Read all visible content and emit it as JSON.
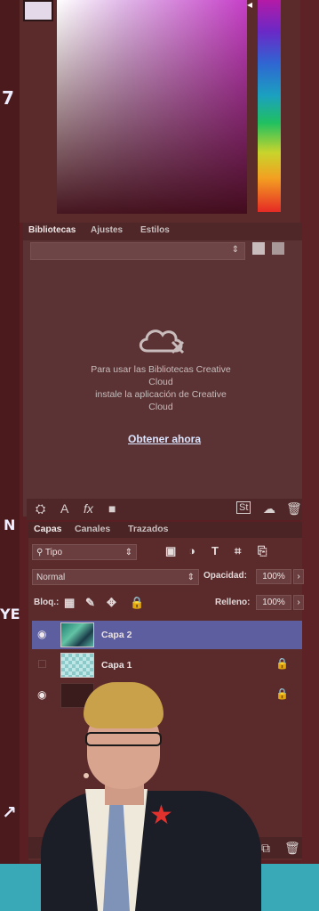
{
  "libraries_panel": {
    "tabs": [
      "Bibliotecas",
      "Ajustes",
      "Estilos"
    ],
    "active_tab": "Bibliotecas",
    "message_lines": [
      "Para usar las Bibliotecas Creative",
      "Cloud",
      "instale la aplicación de Creative",
      "Cloud"
    ],
    "link": "Obtener ahora"
  },
  "layers_panel": {
    "tabs": [
      "Capas",
      "Canales",
      "Trazados"
    ],
    "active_tab": "Capas",
    "filter_label": "Tipo",
    "blend_mode": "Normal",
    "opacity_label": "Opacidad:",
    "opacity_value": "100%",
    "lock_label": "Bloq.:",
    "fill_label": "Relleno:",
    "fill_value": "100%",
    "layers": [
      {
        "name": "Capa 2",
        "visible": true,
        "selected": true,
        "locked": false
      },
      {
        "name": "Capa 1",
        "visible": false,
        "selected": false,
        "locked": true
      },
      {
        "name": "",
        "visible": true,
        "selected": false,
        "locked": true
      }
    ]
  },
  "colors": {
    "panel_bg": "#5b2b2c",
    "selected_layer": "#5d5ea0",
    "link": "#d9e4ff"
  },
  "icons": [
    "cloud-sync-icon",
    "eye-icon",
    "lock-icon",
    "type-icon",
    "trash-icon",
    "grid-view-icon",
    "list-view-icon"
  ]
}
